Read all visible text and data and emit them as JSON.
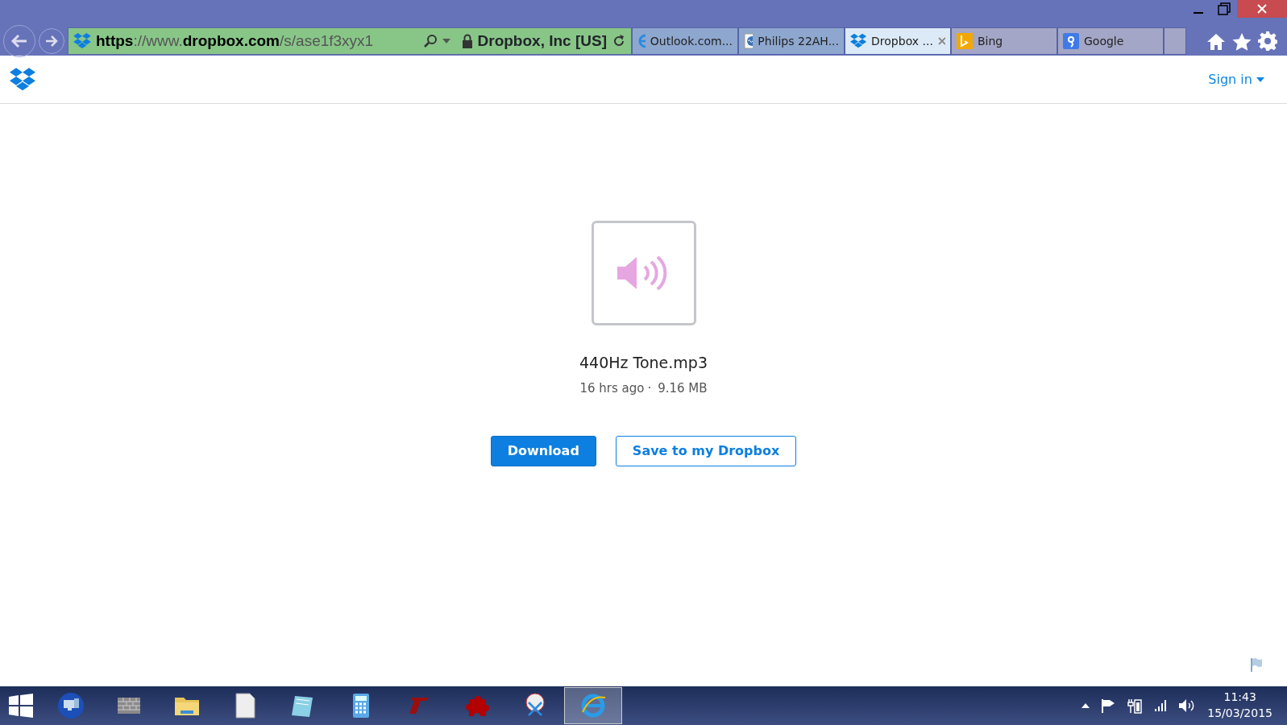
{
  "address_bar": {
    "url": "**https**://www.**dropbox.com**/s/ase1f3xyx1",
    "certificate": "Dropbox, Inc [US]"
  },
  "tabs": [
    {
      "label": "Outlook.com...",
      "selected": false,
      "kind": "ie"
    },
    {
      "label": "Philips 22AH...",
      "selected": false,
      "kind": "page"
    },
    {
      "label": "Dropbox ...",
      "selected": true,
      "kind": "dropbox"
    },
    {
      "label": "Bing",
      "selected": false,
      "kind": "bing"
    },
    {
      "label": "Google",
      "selected": false,
      "kind": "google"
    }
  ],
  "header": {
    "sign_in": "Sign in"
  },
  "file": {
    "name": "440Hz Tone.mp3",
    "age": "16 hrs ago",
    "separator": "·",
    "size": "9.16 MB"
  },
  "buttons": [
    {
      "label": "Download",
      "kind": "primary"
    },
    {
      "label": "Save to my Dropbox",
      "kind": "outline"
    }
  ],
  "taskbar": {
    "apps": [
      {
        "kind": "remote",
        "selected": false
      },
      {
        "kind": "wall",
        "selected": false
      },
      {
        "kind": "folder",
        "selected": false
      },
      {
        "kind": "document",
        "selected": false
      },
      {
        "kind": "notepad",
        "selected": false
      },
      {
        "kind": "calculator",
        "selected": false
      },
      {
        "kind": "lt",
        "selected": false
      },
      {
        "kind": "puzzle",
        "selected": false
      },
      {
        "kind": "scissors",
        "selected": false
      },
      {
        "kind": "ie",
        "selected": true
      }
    ],
    "time": "11:43",
    "date": "15/03/2015"
  }
}
